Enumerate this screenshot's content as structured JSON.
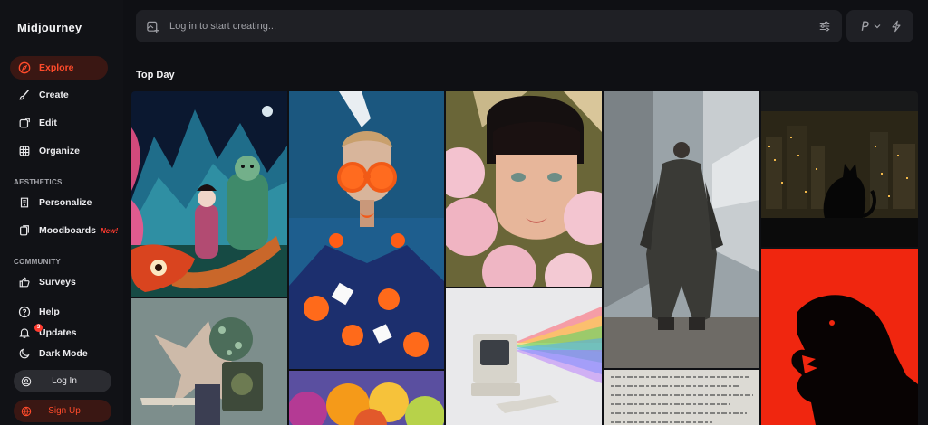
{
  "brand": {
    "name": "Midjourney"
  },
  "nav": {
    "explore": "Explore",
    "create": "Create",
    "edit": "Edit",
    "organize": "Organize",
    "aesthetics_label": "AESTHETICS",
    "personalize": "Personalize",
    "moodboards": "Moodboards",
    "moodboards_badge": "New!",
    "community_label": "COMMUNITY",
    "surveys": "Surveys",
    "help": "Help",
    "updates": "Updates",
    "updates_count": "3",
    "dark_mode": "Dark Mode",
    "log_in": "Log In",
    "sign_up": "Sign Up"
  },
  "prompt": {
    "placeholder": "Log in to start creating..."
  },
  "mode": {
    "label": "P"
  },
  "section_title": "Top Day",
  "gallery": {
    "tiles": [
      "fantasy-boat-scene",
      "creature-portrait",
      "fashion-sunglasses-portrait",
      "colorful-spheres",
      "flower-portrait",
      "retro-computer-rainbow",
      "cloaked-figure-concrete",
      "handwritten-paper",
      "cat-city-night",
      "red-beast-silhouette"
    ]
  },
  "colors": {
    "accent": "#ff4b2b",
    "active_bg": "#3a1713",
    "background": "#0f1014",
    "panel": "#1f2025"
  }
}
